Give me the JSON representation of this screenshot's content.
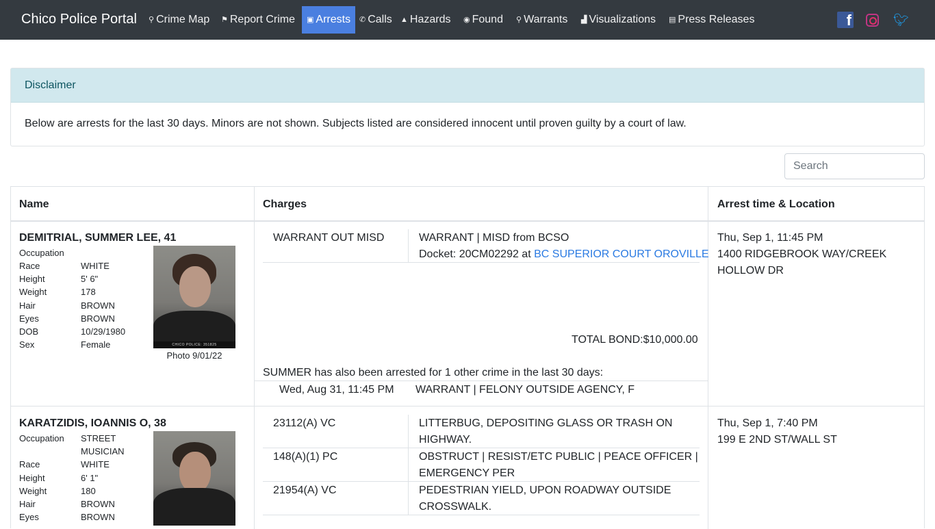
{
  "nav": {
    "brand": "Chico Police Portal",
    "items": [
      {
        "icon": "map-marker-icon",
        "glyph": "⚲",
        "label": "Crime Map"
      },
      {
        "icon": "flag-icon",
        "glyph": "⚑",
        "label": "Report Crime"
      },
      {
        "icon": "id-card-icon",
        "glyph": "▣",
        "label": "Arrests"
      },
      {
        "icon": "phone-icon",
        "glyph": "✆",
        "label": "Calls"
      },
      {
        "icon": "warning-icon",
        "glyph": "▲",
        "label": "Hazards"
      },
      {
        "icon": "compass-icon",
        "glyph": "◉",
        "label": "Found"
      },
      {
        "icon": "search-icon",
        "glyph": "⚲",
        "label": "Warrants"
      },
      {
        "icon": "chart-icon",
        "glyph": "▟",
        "label": "Visualizations"
      },
      {
        "icon": "newspaper-icon",
        "glyph": "▤",
        "label": "Press Releases"
      }
    ],
    "active": "Arrests",
    "active_color": "#4a7fe0",
    "bg_color": "#343a40",
    "social": [
      "facebook-icon",
      "instagram-icon",
      "twitter-icon"
    ]
  },
  "disclaimer": {
    "title": "Disclaimer",
    "text": "Below are arrests for the last 30 days. Minors are not shown. Subjects listed are considered innocent until proven guilty by a court of law."
  },
  "search": {
    "placeholder": "Search"
  },
  "table": {
    "headers": {
      "name": "Name",
      "charges": "Charges",
      "arrest": "Arrest time & Location"
    },
    "rows": [
      {
        "name": "DEMITRIAL, SUMMER LEE, 41",
        "details": {
          "occupation_label": "Occupation",
          "occupation": "",
          "race_label": "Race",
          "race": "WHITE",
          "height_label": "Height",
          "height": "5' 6\"",
          "weight_label": "Weight",
          "weight": "178",
          "hair_label": "Hair",
          "hair": "BROWN",
          "eyes_label": "Eyes",
          "eyes": "BROWN",
          "dob_label": "DOB",
          "dob": "10/29/1980",
          "sex_label": "Sex",
          "sex": "Female"
        },
        "photo_strip": "CHICO POLICE: 351825",
        "photo_caption": "Photo 9/01/22",
        "charges": [
          {
            "code": "WARRANT OUT MISD",
            "desc_line1": "WARRANT | MISD from BCSO",
            "docket_prefix": "Docket: 20CM02292 at ",
            "court": "BC SUPERIOR COURT OROVILLE"
          }
        ],
        "total_bond": "TOTAL BOND:$10,000.00",
        "other_note": "SUMMER has also been arrested for 1 other crime in the last 30 days:",
        "other": {
          "time": "Wed, Aug 31, 11:45 PM",
          "desc": "WARRANT | FELONY OUTSIDE AGENCY, F"
        },
        "arrest_time": "Thu, Sep 1, 11:45 PM",
        "location_line1": "1400 RIDGEBROOK WAY/CREEK",
        "location_line2": "HOLLOW DR"
      },
      {
        "name": "KARATZIDIS, IOANNIS O, 38",
        "details": {
          "occupation_label": "Occupation",
          "occupation_line1": "STREET",
          "occupation_line2": "MUSICIAN",
          "race_label": "Race",
          "race": "WHITE",
          "height_label": "Height",
          "height": "6' 1\"",
          "weight_label": "Weight",
          "weight": "180",
          "hair_label": "Hair",
          "hair": "BROWN",
          "eyes_label": "Eyes",
          "eyes": "BROWN"
        },
        "charges": [
          {
            "code": "23112(A) VC",
            "desc_line1": "LITTERBUG, DEPOSITING GLASS OR TRASH ON",
            "desc_line2": "HIGHWAY."
          },
          {
            "code": "148(A)(1) PC",
            "desc_line1": "OBSTRUCT | RESIST/ETC PUBLIC | PEACE OFFICER |",
            "desc_line2": "EMERGENCY PER"
          },
          {
            "code": "21954(A) VC",
            "desc_line1": "PEDESTRIAN YIELD, UPON ROADWAY OUTSIDE",
            "desc_line2": "CROSSWALK."
          }
        ],
        "arrest_time": "Thu, Sep 1, 7:40 PM",
        "location_line1": "199 E 2ND ST/WALL ST"
      }
    ]
  }
}
